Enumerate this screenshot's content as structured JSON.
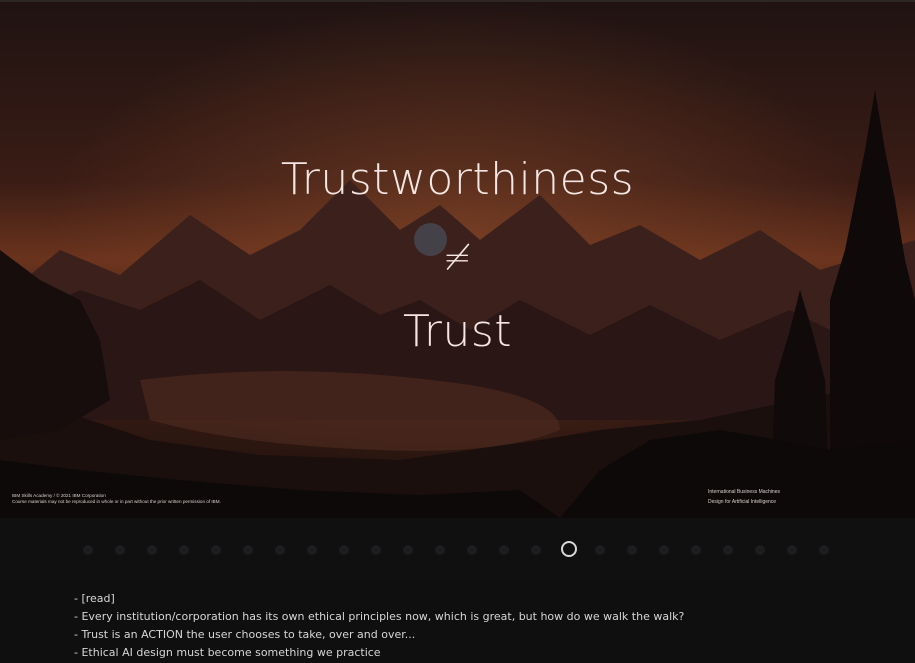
{
  "slide": {
    "title_line1": "Trustworthiness",
    "title_symbol": "≠",
    "title_line3": "Trust",
    "footer_left_line1": "IBM Skills Academy / © 2021 IBM Corporation",
    "footer_left_line2": "Course materials may not be reproduced in whole or in part without the prior written permission of IBM.",
    "footer_right_line1": "International Business Machines",
    "footer_right_line2": "Design for Artificial Intelligence"
  },
  "navigation": {
    "total_slides": 24,
    "current_index": 15
  },
  "notes": [
    "- [read]",
    "- Every institution/corporation has its own ethical principles now, which is great, but how do we walk the walk?",
    "- Trust is an ACTION the user chooses to take, over and over...",
    "- Ethical AI design must become something we practice"
  ],
  "colors": {
    "sky_top": "#221312",
    "sky_glow": "#7a3a22",
    "mountains_far": "#3d1f1b",
    "mountains_near": "#2a1614",
    "forest": "#120b0b",
    "dot_inactive": "#1d1d1f",
    "dot_active_ring": "#d8d8d8"
  }
}
